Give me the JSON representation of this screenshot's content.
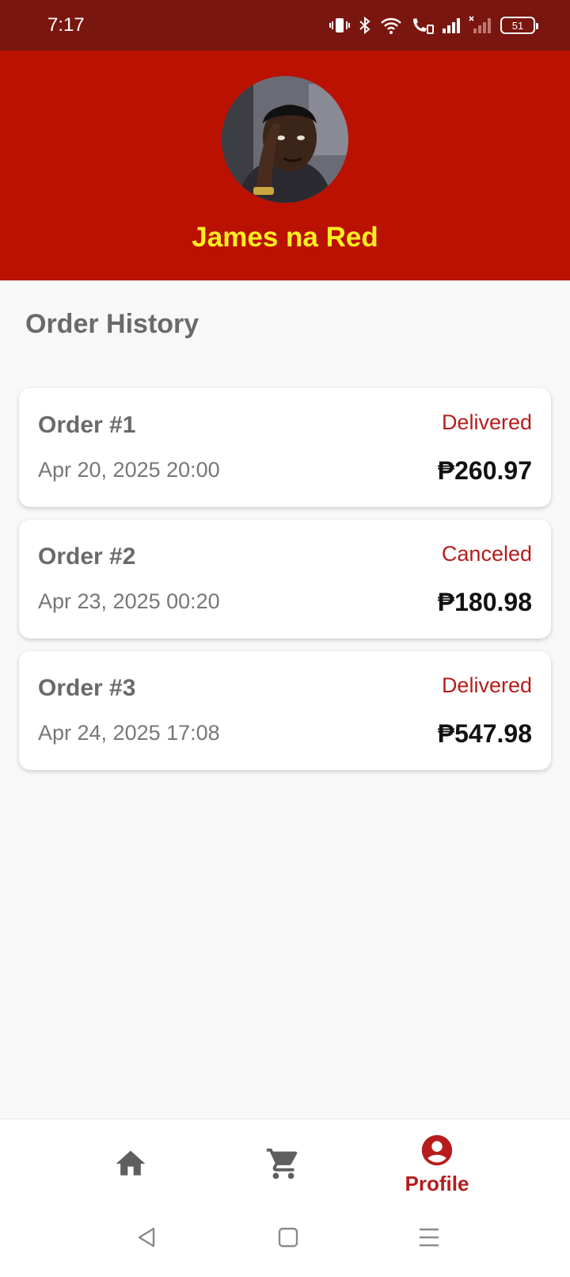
{
  "status_bar": {
    "time": "7:17",
    "battery": "51",
    "icons": [
      "vibrate-icon",
      "bluetooth-icon",
      "wifi-icon",
      "volte-icon",
      "signal-icon",
      "signal-no-sim-icon",
      "battery-icon"
    ]
  },
  "profile": {
    "name": "James na Red",
    "avatar_icon": "avatar-photo"
  },
  "section": {
    "title": "Order History"
  },
  "orders": [
    {
      "title": "Order #1",
      "date": "Apr 20, 2025 20:00",
      "status": "Delivered",
      "total": "₱260.97"
    },
    {
      "title": "Order #2",
      "date": "Apr 23, 2025 00:20",
      "status": "Canceled",
      "total": "₱180.98"
    },
    {
      "title": "Order #3",
      "date": "Apr 24, 2025 17:08",
      "status": "Delivered",
      "total": "₱547.98"
    }
  ],
  "bottom_nav": {
    "items": [
      {
        "icon": "home-icon",
        "label": ""
      },
      {
        "icon": "cart-icon",
        "label": ""
      },
      {
        "icon": "account-circle-icon",
        "label": "Profile"
      }
    ],
    "active_index": 2
  },
  "colors": {
    "status_bar": "#7a1610",
    "header": "#bb1100",
    "name": "#ffee22",
    "accent": "#b71c1c",
    "inactive_icon": "#5f5f5f"
  }
}
